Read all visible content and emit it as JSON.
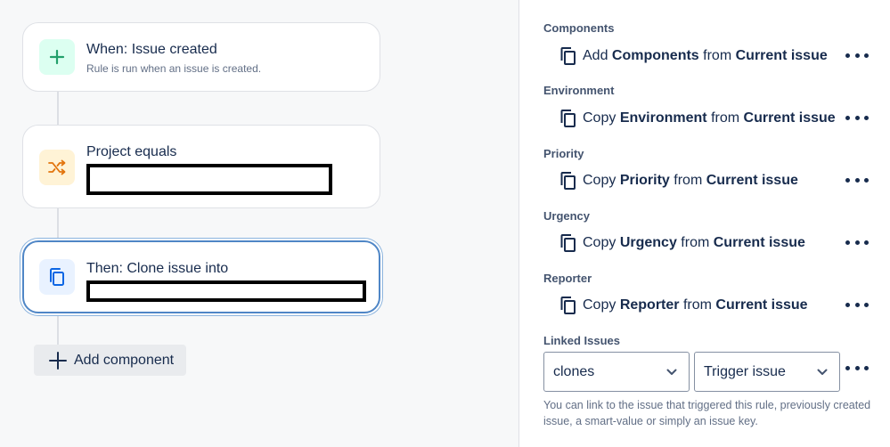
{
  "rule": {
    "trigger": {
      "title": "When: Issue created",
      "subtitle": "Rule is run when an issue is created.",
      "icon": "plus-icon",
      "color": "#22a06b"
    },
    "condition": {
      "title": "Project equals",
      "icon": "shuffle-icon",
      "color": "#e2740d"
    },
    "action": {
      "title": "Then: Clone issue into",
      "icon": "copy-icon",
      "color": "#0c66e4"
    },
    "add_component_label": "Add component"
  },
  "panel": {
    "fields": [
      {
        "label": "Components",
        "verb": "Add",
        "field": "Components",
        "from": "from",
        "source": "Current issue"
      },
      {
        "label": "Environment",
        "verb": "Copy",
        "field": "Environment",
        "from": "from",
        "source": "Current issue"
      },
      {
        "label": "Priority",
        "verb": "Copy",
        "field": "Priority",
        "from": "from",
        "source": "Current issue"
      },
      {
        "label": "Urgency",
        "verb": "Copy",
        "field": "Urgency",
        "from": "from",
        "source": "Current issue"
      },
      {
        "label": "Reporter",
        "verb": "Copy",
        "field": "Reporter",
        "from": "from",
        "source": "Current issue"
      }
    ],
    "linked_issues": {
      "label": "Linked Issues",
      "link_type": "clones",
      "target": "Trigger issue",
      "helper": "You can link to the issue that triggered this rule, previously created issue, a smart-value or simply an issue key."
    }
  },
  "colors": {
    "selected_border": "#4f86c6",
    "text": "#172b4d",
    "subtle": "#626f86"
  }
}
